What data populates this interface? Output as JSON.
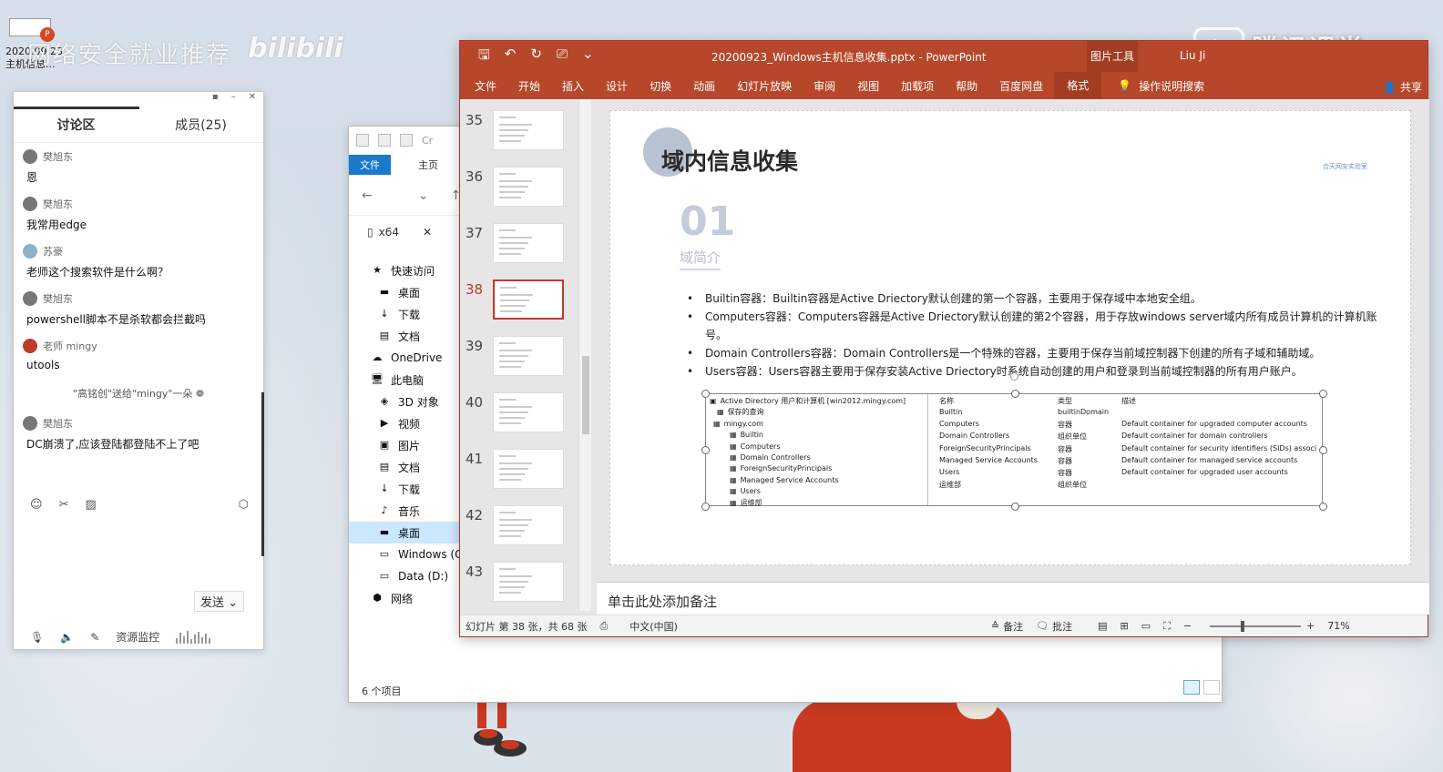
{
  "desktop": {
    "watermark_text": "网络安全就业推荐",
    "watermark_brand": "bilibili",
    "icon_label": "2020.09.23 主机信息...",
    "tencent_brand": "腾讯课堂"
  },
  "chat": {
    "tabs": [
      "讨论区",
      "成员(25)"
    ],
    "messages": [
      {
        "name": "樊旭东",
        "text": "恩"
      },
      {
        "name": "樊旭东",
        "text": "我常用edge"
      },
      {
        "name": "苏豪",
        "text": "老师这个搜索软件是什么啊？"
      },
      {
        "name": "樊旭东",
        "text": "powershell脚本不是杀软都会拦截吗"
      },
      {
        "name": "老师 mingy",
        "text": "utools"
      }
    ],
    "system_note": "\"高铭创\"送给\"mingy\"一朵 ❁",
    "last_message": {
      "name": "樊旭东",
      "text": "DC崩溃了,应该登陆都登陆不上了吧"
    },
    "send_label": "发送",
    "monitor_label": "资源监控"
  },
  "explorer": {
    "title_fragment": "Cr",
    "ribbon_file": "文件",
    "ribbon_home": "主页",
    "search_text": "x64",
    "tree": [
      {
        "icon": "star-icon",
        "label": "快速访问",
        "level": "top"
      },
      {
        "icon": "desktop-icon",
        "label": "桌面",
        "level": "sub"
      },
      {
        "icon": "download-icon",
        "label": "下载",
        "level": "sub"
      },
      {
        "icon": "document-icon",
        "label": "文档",
        "level": "sub"
      },
      {
        "icon": "cloud-icon",
        "label": "OneDrive",
        "level": "top"
      },
      {
        "icon": "computer-icon",
        "label": "此电脑",
        "level": "top"
      },
      {
        "icon": "cube-icon",
        "label": "3D 对象",
        "level": "sub"
      },
      {
        "icon": "video-icon",
        "label": "视频",
        "level": "sub"
      },
      {
        "icon": "picture-icon",
        "label": "图片",
        "level": "sub"
      },
      {
        "icon": "document-icon",
        "label": "文档",
        "level": "sub"
      },
      {
        "icon": "download-icon",
        "label": "下载",
        "level": "sub"
      },
      {
        "icon": "music-icon",
        "label": "音乐",
        "level": "sub"
      },
      {
        "icon": "desktop-icon",
        "label": "桌面",
        "level": "sub",
        "selected": true
      },
      {
        "icon": "drive-icon",
        "label": "Windows (C",
        "level": "sub"
      },
      {
        "icon": "drive-icon",
        "label": "Data (D:)",
        "level": "sub"
      },
      {
        "icon": "network-icon",
        "label": "网络",
        "level": "top"
      }
    ],
    "status": "6 个项目"
  },
  "ppt": {
    "title": "20200923_Windows主机信息收集.pptx  -  PowerPoint",
    "context_tab": "图片工具",
    "user": "Liu Ji",
    "menu": [
      "文件",
      "开始",
      "插入",
      "设计",
      "切换",
      "动画",
      "幻灯片放映",
      "审阅",
      "视图",
      "加载项",
      "帮助",
      "百度网盘"
    ],
    "format_tab": "格式",
    "tell_me": "操作说明搜索",
    "share": "共享",
    "thumbnails": [
      {
        "num": "35",
        "active": false
      },
      {
        "num": "36",
        "active": false
      },
      {
        "num": "37",
        "active": false
      },
      {
        "num": "38",
        "active": true
      },
      {
        "num": "39",
        "active": false
      },
      {
        "num": "40",
        "active": false
      },
      {
        "num": "41",
        "active": false
      },
      {
        "num": "42",
        "active": false
      },
      {
        "num": "43",
        "active": false
      }
    ],
    "slide": {
      "title": "域内信息收集",
      "logo_text": "合天网安实验室",
      "section_num": "01",
      "section_sub": "域简介",
      "bullets": [
        "Builtin容器：Builtin容器是Active Driectory默认创建的第一个容器，主要用于保存域中本地安全组。",
        "Computers容器：Computers容器是Active Driectory默认创建的第2个容器，用于存放windows server域内所有成员计算机的计算机账号。",
        "Domain Controllers容器：Domain Controllers是一个特殊的容器，主要用于保存当前域控制器下创建的所有子域和辅助域。",
        "Users容器：Users容器主要用于保存安装Active Driectory时系统自动创建的用户和登录到当前域控制器的所有用户账户。"
      ],
      "ad_tree": [
        "Active Directory 用户和计算机 [win2012.mingy.com]",
        "保存的查询",
        "mingy.com",
        "Builtin",
        "Computers",
        "Domain Controllers",
        "ForeignSecurityPrincipals",
        "Managed Service Accounts",
        "Users",
        "运维部"
      ],
      "ad_headers": [
        "名称",
        "类型",
        "描述"
      ],
      "ad_rows": [
        [
          "Builtin",
          "builtinDomain",
          ""
        ],
        [
          "Computers",
          "容器",
          "Default container for upgraded computer accounts"
        ],
        [
          "Domain Controllers",
          "组织单位",
          "Default container for domain controllers"
        ],
        [
          "ForeignSecurityPrincipals",
          "容器",
          "Default container for security identifiers (SIDs) associ"
        ],
        [
          "Managed Service Accounts",
          "容器",
          "Default container for managed service accounts"
        ],
        [
          "Users",
          "容器",
          "Default container for upgraded user accounts"
        ],
        [
          "运维部",
          "组织单位",
          ""
        ]
      ]
    },
    "notes_placeholder": "单击此处添加备注",
    "status": {
      "slide_info": "幻灯片 第 38 张，共 68 张",
      "language": "中文(中国)",
      "notes": "备注",
      "comments": "批注",
      "zoom": "71%"
    }
  }
}
